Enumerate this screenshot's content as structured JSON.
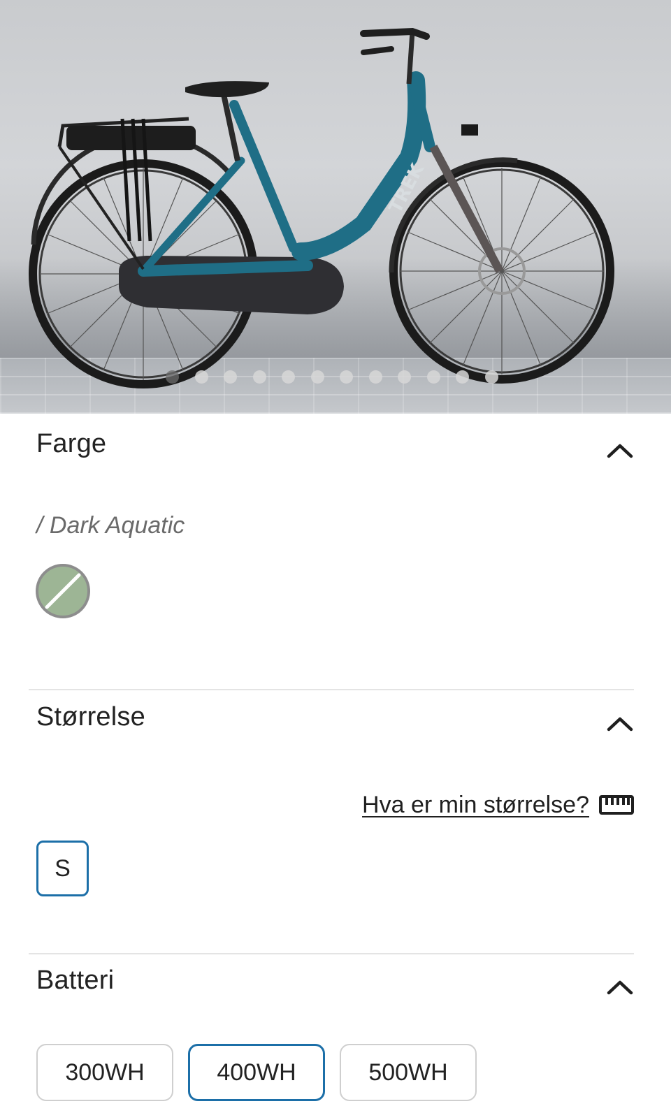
{
  "gallery": {
    "image_alt": "Trek bicycle photo",
    "dot_count": 12,
    "active_dot": 0
  },
  "color_section": {
    "title": "Farge",
    "selected_color_label": "/ Dark Aquatic",
    "swatch_color": "#9db595"
  },
  "size_section": {
    "title": "Størrelse",
    "size_guide_link": "Hva er min størrelse?",
    "size_guide_icon": "ruler-icon",
    "sizes": [
      "S"
    ],
    "selected_size": "S"
  },
  "battery_section": {
    "title": "Batteri",
    "options": [
      "300WH",
      "400WH",
      "500WH"
    ],
    "selected": "400WH"
  },
  "colors": {
    "accent": "#1c6fa8",
    "divider": "#e4e4e4",
    "bike_frame": "#1f6e86"
  }
}
